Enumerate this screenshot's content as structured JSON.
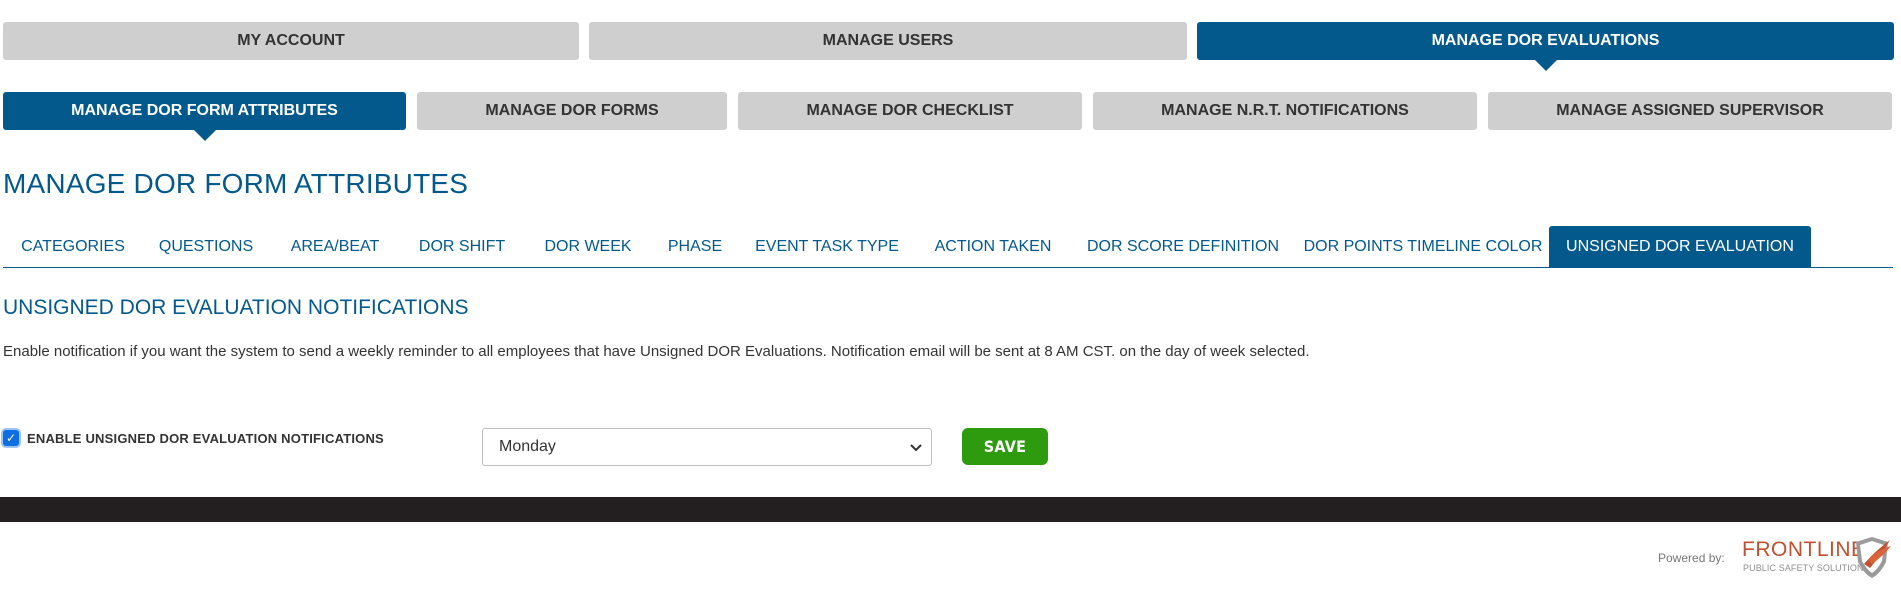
{
  "top_nav": [
    {
      "label": "MY ACCOUNT"
    },
    {
      "label": "MANAGE USERS"
    },
    {
      "label": "MANAGE DOR EVALUATIONS"
    }
  ],
  "sub_nav": [
    {
      "label": "MANAGE DOR FORM ATTRIBUTES"
    },
    {
      "label": "MANAGE DOR FORMS"
    },
    {
      "label": "MANAGE DOR CHECKLIST"
    },
    {
      "label": "MANAGE N.R.T. NOTIFICATIONS"
    },
    {
      "label": "MANAGE ASSIGNED SUPERVISOR"
    }
  ],
  "page_title": "MANAGE DOR FORM ATTRIBUTES",
  "tabs": [
    {
      "label": "CATEGORIES"
    },
    {
      "label": "QUESTIONS"
    },
    {
      "label": "AREA/BEAT"
    },
    {
      "label": "DOR SHIFT"
    },
    {
      "label": "DOR WEEK"
    },
    {
      "label": "PHASE"
    },
    {
      "label": "EVENT TASK TYPE"
    },
    {
      "label": "ACTION TAKEN"
    },
    {
      "label": "DOR SCORE DEFINITION"
    },
    {
      "label": "DOR POINTS TIMELINE COLOR"
    },
    {
      "label": "UNSIGNED DOR EVALUATION"
    }
  ],
  "section": {
    "title": "UNSIGNED DOR EVALUATION NOTIFICATIONS",
    "description": "Enable notification if you want the system to send a weekly reminder to all employees that have Unsigned DOR Evaluations. Notification email will be sent at 8 AM CST. on the day of week selected.",
    "checkbox_label": "ENABLE UNSIGNED DOR EVALUATION NOTIFICATIONS",
    "checkbox_checked": true,
    "day_select_value": "Monday",
    "save_label": "SAVE"
  },
  "footer": {
    "powered_by": "Powered by:",
    "logo_name": "FRONTLINE",
    "logo_sub": "PUBLIC SAFETY SOLUTIONS"
  },
  "colors": {
    "primary": "#03598c",
    "inactive_button": "#cfcfcf",
    "save_green": "#2e9a0e",
    "footer_bar": "#231f20",
    "logo_orange": "#c0502f"
  },
  "icons": {
    "checkbox": "check-icon",
    "select": "chevron-down-icon",
    "logo": "shield-icon"
  }
}
